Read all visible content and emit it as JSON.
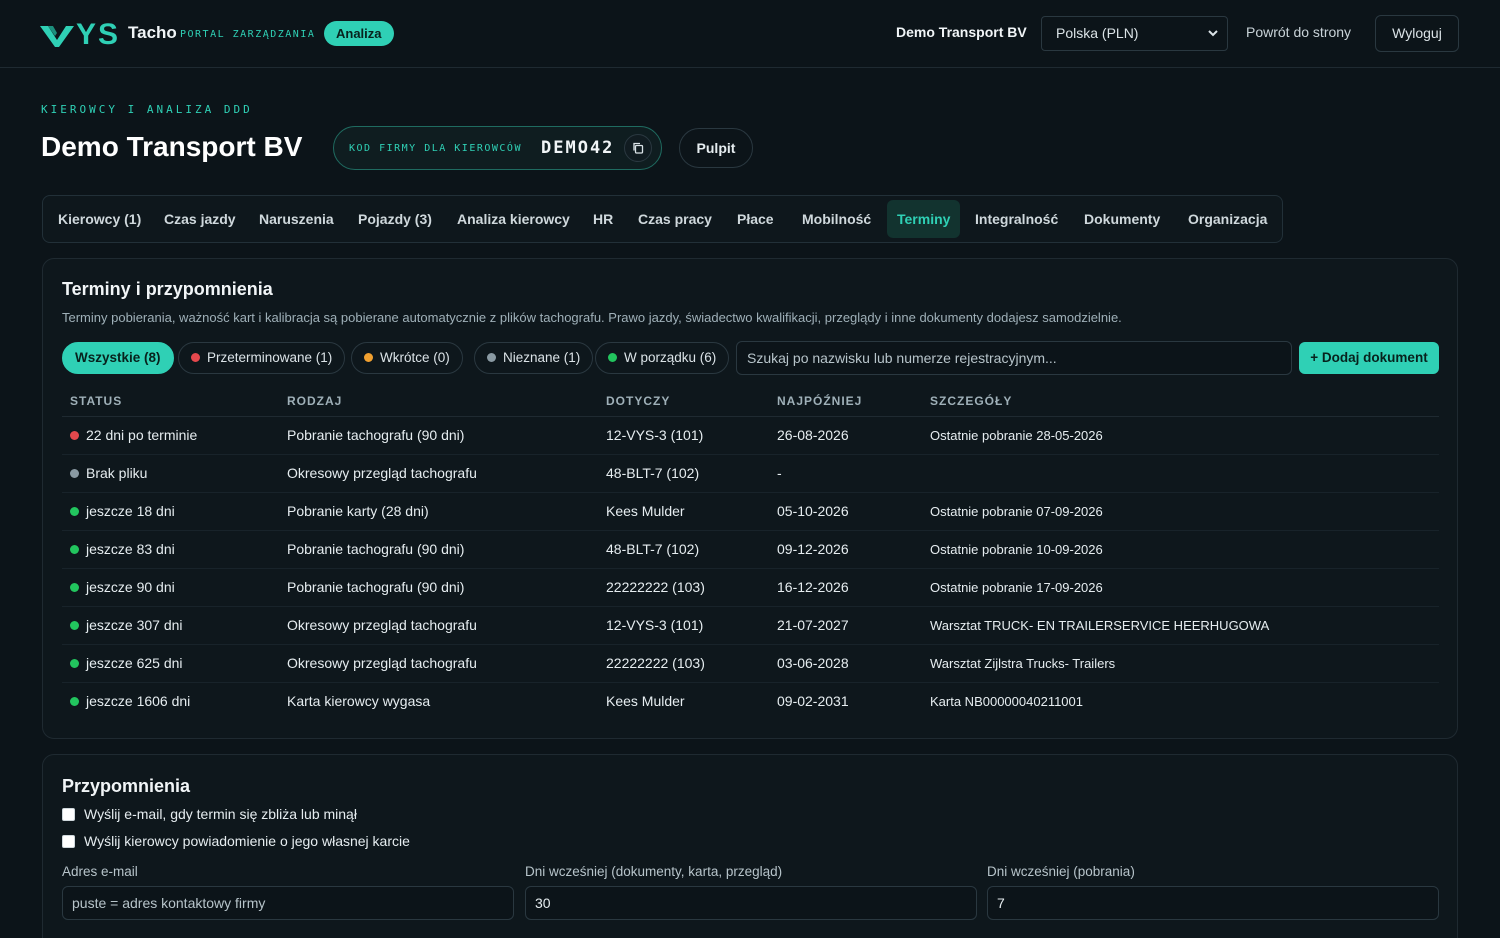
{
  "header": {
    "brand_short": "YS",
    "brand_name": "Tacho",
    "brand_sub": "PORTAL ZARZĄDZANIA",
    "badge": "Analiza",
    "company": "Demo Transport BV",
    "country_select": "Polska (PLN)",
    "back_link": "Powrót do strony",
    "logout": "Wyloguj"
  },
  "page": {
    "eyebrow": "KIEROWCY I ANALIZA DDD",
    "title": "Demo Transport BV",
    "code_label": "KOD FIRMY DLA KIEROWCÓW",
    "code_value": "DEMO42",
    "pulpit": "Pulpit"
  },
  "tabs": [
    {
      "label": "Kierowcy (1)"
    },
    {
      "label": "Czas jazdy"
    },
    {
      "label": "Naruszenia"
    },
    {
      "label": "Pojazdy (3)"
    },
    {
      "label": "Analiza kierowcy"
    },
    {
      "label": "HR"
    },
    {
      "label": "Czas pracy"
    },
    {
      "label": "Płace"
    },
    {
      "label": "Mobilność"
    },
    {
      "label": "Terminy"
    },
    {
      "label": "Integralność"
    },
    {
      "label": "Dokumenty"
    },
    {
      "label": "Organizacja"
    }
  ],
  "active_tab": "Terminy",
  "deadlines": {
    "title": "Terminy i przypomnienia",
    "description": "Terminy pobierania, ważność kart i kalibracja są pobierane automatycznie z plików tachografu. Prawo jazdy, świadectwo kwalifikacji, przeglądy i inne dokumenty dodajesz samodzielnie.",
    "filters": [
      {
        "label": "Wszystkie (8)",
        "color": ""
      },
      {
        "label": "Przeterminowane (1)",
        "color": "#e5484d"
      },
      {
        "label": "Wkrótce (0)",
        "color": "#f0a030"
      },
      {
        "label": "Nieznane (1)",
        "color": "#8a9aa3"
      },
      {
        "label": "W porządku (6)",
        "color": "#22c55e"
      }
    ],
    "search_placeholder": "Szukaj po nazwisku lub numerze rejestracyjnym...",
    "add_button": "+ Dodaj dokument",
    "columns": [
      "STATUS",
      "RODZAJ",
      "DOTYCZY",
      "NAJPÓŹNIEJ",
      "SZCZEGÓŁY"
    ],
    "rows": [
      {
        "status": "22 dni po terminie",
        "color": "#e5484d",
        "kind": "Pobranie tachografu (90 dni)",
        "subject": "12-VYS-3 (101)",
        "deadline": "26-08-2026",
        "details": "Ostatnie pobranie 28-05-2026"
      },
      {
        "status": "Brak pliku",
        "color": "#8a9aa3",
        "kind": "Okresowy przegląd tachografu",
        "subject": "48-BLT-7 (102)",
        "deadline": "-",
        "details": ""
      },
      {
        "status": "jeszcze 18 dni",
        "color": "#22c55e",
        "kind": "Pobranie karty (28 dni)",
        "subject": "Kees Mulder",
        "deadline": "05-10-2026",
        "details": "Ostatnie pobranie 07-09-2026"
      },
      {
        "status": "jeszcze 83 dni",
        "color": "#22c55e",
        "kind": "Pobranie tachografu (90 dni)",
        "subject": "48-BLT-7 (102)",
        "deadline": "09-12-2026",
        "details": "Ostatnie pobranie 10-09-2026"
      },
      {
        "status": "jeszcze 90 dni",
        "color": "#22c55e",
        "kind": "Pobranie tachografu (90 dni)",
        "subject": "22222222 (103)",
        "deadline": "16-12-2026",
        "details": "Ostatnie pobranie 17-09-2026"
      },
      {
        "status": "jeszcze 307 dni",
        "color": "#22c55e",
        "kind": "Okresowy przegląd tachografu",
        "subject": "12-VYS-3 (101)",
        "deadline": "21-07-2027",
        "details": "Warsztat TRUCK- EN TRAILERSERVICE HEERHUGOWA"
      },
      {
        "status": "jeszcze 625 dni",
        "color": "#22c55e",
        "kind": "Okresowy przegląd tachografu",
        "subject": "22222222 (103)",
        "deadline": "03-06-2028",
        "details": "Warsztat Zijlstra Trucks- Trailers"
      },
      {
        "status": "jeszcze 1606 dni",
        "color": "#22c55e",
        "kind": "Karta kierowcy wygasa",
        "subject": "Kees Mulder",
        "deadline": "09-02-2031",
        "details": "Karta NB00000040211001"
      }
    ]
  },
  "reminders": {
    "title": "Przypomnienia",
    "checkbox_email": "Wyślij e-mail, gdy termin się zbliża lub minął",
    "checkbox_driver": "Wyślij kierowcy powiadomienie o jego własnej karcie",
    "email_label": "Adres e-mail",
    "email_placeholder": "puste = adres kontaktowy firmy",
    "days_docs_label": "Dni wcześniej (dokumenty, karta, przegląd)",
    "days_docs_value": "30",
    "days_downloads_label": "Dni wcześniej (pobrania)",
    "days_downloads_value": "7"
  },
  "colors": {
    "accent": "#2fd0b5",
    "background": "#0c1419",
    "overdue": "#e5484d",
    "unknown": "#8a9aa3",
    "ok": "#22c55e"
  }
}
